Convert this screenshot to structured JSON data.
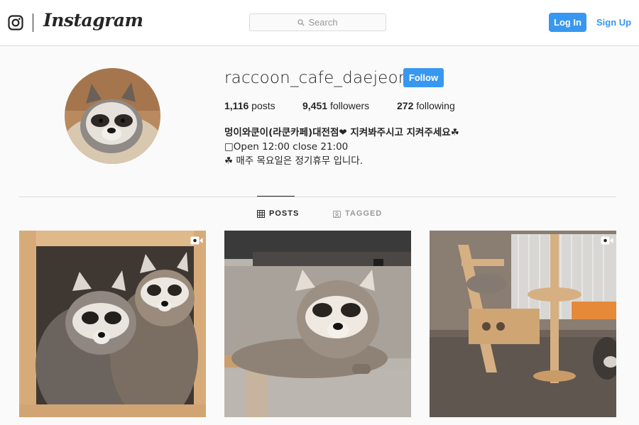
{
  "header": {
    "wordmark": "Instagram",
    "search_placeholder": "Search",
    "login_label": "Log In",
    "signup_label": "Sign Up"
  },
  "profile": {
    "username": "raccoon_cafe_daejeon",
    "follow_label": "Follow",
    "stats": {
      "posts_count": "1,116",
      "posts_label": "posts",
      "followers_count": "9,451",
      "followers_label": "followers",
      "following_count": "272",
      "following_label": "following"
    },
    "bio": {
      "name": "멍이와쿤이(라쿤카페)대전점❤ 지켜봐주시고 지켜주세요☘",
      "line1": "□Open 12:00 close 21:00",
      "line2": "☘ 매주 목요일은 정기휴무 입니다."
    }
  },
  "tabs": [
    {
      "label": "POSTS",
      "icon": "grid-icon",
      "active": true
    },
    {
      "label": "TAGGED",
      "icon": "tagged-icon",
      "active": false
    }
  ],
  "posts": [
    {
      "icon": "video-icon",
      "subject": "two raccoons in a wooden box"
    },
    {
      "icon": "",
      "subject": "raccoon lying on a wooden shelf"
    },
    {
      "icon": "video-icon",
      "subject": "raccoon on a cat tree by a cage"
    }
  ],
  "colors": {
    "accent": "#3897f0",
    "text": "#262626",
    "muted": "#999999",
    "border": "#dbdbdb",
    "background": "#fafafa"
  }
}
